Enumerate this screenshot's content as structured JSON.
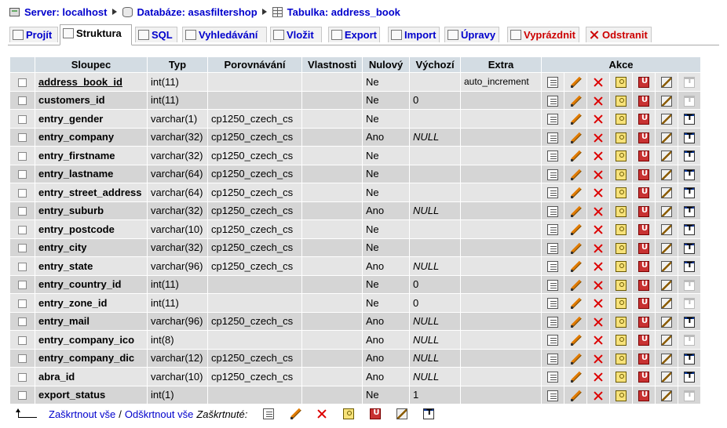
{
  "breadcrumb": [
    {
      "label": "Server: localhost",
      "icon": "server-icon"
    },
    {
      "label": "Databáze: asasfiltershop",
      "icon": "database-icon"
    },
    {
      "label": "Tabulka: address_book",
      "icon": "table-icon"
    }
  ],
  "tabs": [
    {
      "label": "Projít",
      "icon": "browse-icon",
      "active": false
    },
    {
      "label": "Struktura",
      "icon": "structure-icon",
      "active": true
    },
    {
      "label": "SQL",
      "icon": "sql-icon",
      "active": false
    },
    {
      "label": "Vyhledávání",
      "icon": "search-icon",
      "active": false
    },
    {
      "label": "Vložit",
      "icon": "insert-icon",
      "active": false
    },
    {
      "label": "Export",
      "icon": "export-icon",
      "active": false
    },
    {
      "label": "Import",
      "icon": "import-icon",
      "active": false
    },
    {
      "label": "Úpravy",
      "icon": "operations-icon",
      "active": false
    },
    {
      "label": "Vyprázdnit",
      "icon": "empty-icon",
      "active": false,
      "danger": true
    },
    {
      "label": "Odstranit",
      "icon": "drop-icon",
      "active": false,
      "danger": true
    }
  ],
  "table": {
    "headers": {
      "column": "Sloupec",
      "type": "Typ",
      "collation": "Porovnávání",
      "attributes": "Vlastnosti",
      "null": "Nulový",
      "default": "Výchozí",
      "extra": "Extra",
      "actions": "Akce"
    },
    "rows": [
      {
        "name": "address_book_id",
        "type": "int(11)",
        "collation": "",
        "attributes": "",
        "null": "Ne",
        "default": "",
        "extra": "auto_increment",
        "primary": true,
        "fulltext": false
      },
      {
        "name": "customers_id",
        "type": "int(11)",
        "collation": "",
        "attributes": "",
        "null": "Ne",
        "default": "0",
        "extra": "",
        "primary": false,
        "fulltext": false
      },
      {
        "name": "entry_gender",
        "type": "varchar(1)",
        "collation": "cp1250_czech_cs",
        "attributes": "",
        "null": "Ne",
        "default": "",
        "extra": "",
        "primary": false,
        "fulltext": true
      },
      {
        "name": "entry_company",
        "type": "varchar(32)",
        "collation": "cp1250_czech_cs",
        "attributes": "",
        "null": "Ano",
        "default": "NULL",
        "extra": "",
        "primary": false,
        "fulltext": true
      },
      {
        "name": "entry_firstname",
        "type": "varchar(32)",
        "collation": "cp1250_czech_cs",
        "attributes": "",
        "null": "Ne",
        "default": "",
        "extra": "",
        "primary": false,
        "fulltext": true
      },
      {
        "name": "entry_lastname",
        "type": "varchar(64)",
        "collation": "cp1250_czech_cs",
        "attributes": "",
        "null": "Ne",
        "default": "",
        "extra": "",
        "primary": false,
        "fulltext": true
      },
      {
        "name": "entry_street_address",
        "type": "varchar(64)",
        "collation": "cp1250_czech_cs",
        "attributes": "",
        "null": "Ne",
        "default": "",
        "extra": "",
        "primary": false,
        "fulltext": true
      },
      {
        "name": "entry_suburb",
        "type": "varchar(32)",
        "collation": "cp1250_czech_cs",
        "attributes": "",
        "null": "Ano",
        "default": "NULL",
        "extra": "",
        "primary": false,
        "fulltext": true
      },
      {
        "name": "entry_postcode",
        "type": "varchar(10)",
        "collation": "cp1250_czech_cs",
        "attributes": "",
        "null": "Ne",
        "default": "",
        "extra": "",
        "primary": false,
        "fulltext": true
      },
      {
        "name": "entry_city",
        "type": "varchar(32)",
        "collation": "cp1250_czech_cs",
        "attributes": "",
        "null": "Ne",
        "default": "",
        "extra": "",
        "primary": false,
        "fulltext": true
      },
      {
        "name": "entry_state",
        "type": "varchar(96)",
        "collation": "cp1250_czech_cs",
        "attributes": "",
        "null": "Ano",
        "default": "NULL",
        "extra": "",
        "primary": false,
        "fulltext": true
      },
      {
        "name": "entry_country_id",
        "type": "int(11)",
        "collation": "",
        "attributes": "",
        "null": "Ne",
        "default": "0",
        "extra": "",
        "primary": false,
        "fulltext": false
      },
      {
        "name": "entry_zone_id",
        "type": "int(11)",
        "collation": "",
        "attributes": "",
        "null": "Ne",
        "default": "0",
        "extra": "",
        "primary": false,
        "fulltext": false
      },
      {
        "name": "entry_mail",
        "type": "varchar(96)",
        "collation": "cp1250_czech_cs",
        "attributes": "",
        "null": "Ano",
        "default": "NULL",
        "extra": "",
        "primary": false,
        "fulltext": true
      },
      {
        "name": "entry_company_ico",
        "type": "int(8)",
        "collation": "",
        "attributes": "",
        "null": "Ano",
        "default": "NULL",
        "extra": "",
        "primary": false,
        "fulltext": false
      },
      {
        "name": "entry_company_dic",
        "type": "varchar(12)",
        "collation": "cp1250_czech_cs",
        "attributes": "",
        "null": "Ano",
        "default": "NULL",
        "extra": "",
        "primary": false,
        "fulltext": true
      },
      {
        "name": "abra_id",
        "type": "varchar(10)",
        "collation": "cp1250_czech_cs",
        "attributes": "",
        "null": "Ano",
        "default": "NULL",
        "extra": "",
        "primary": false,
        "fulltext": true
      },
      {
        "name": "export_status",
        "type": "int(1)",
        "collation": "",
        "attributes": "",
        "null": "Ne",
        "default": "1",
        "extra": "",
        "primary": false,
        "fulltext": false
      }
    ]
  },
  "footer": {
    "check_all": "Zaškrtnout vše",
    "separator": "/",
    "uncheck_all": "Odškrtnout vše",
    "with_selected": "Zaškrtnuté:"
  },
  "action_icons": [
    "browse-icon",
    "edit-icon",
    "drop-icon",
    "primary-key-icon",
    "unique-icon",
    "index-icon",
    "fulltext-icon"
  ]
}
